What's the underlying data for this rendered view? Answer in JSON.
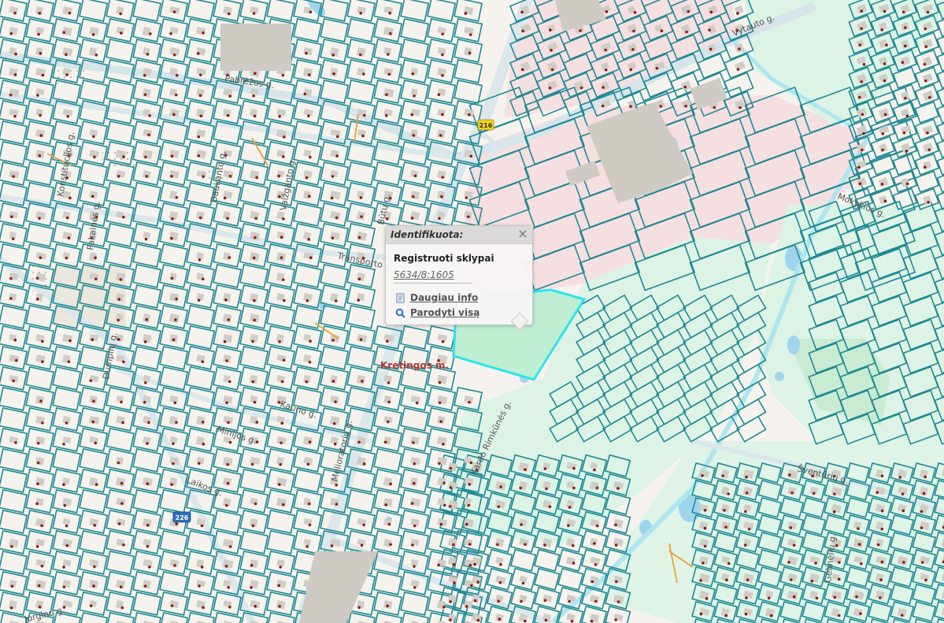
{
  "map": {
    "streets": [
      "Vytauto g.",
      "Pabrėžos g.",
      "Konstitucijos g.",
      "Daukanto g.",
      "Vaižganto g.",
      "Pakalnės g.",
      "Būtų g.",
      "Transporto g.",
      "Kauno g.",
      "Melioratorių g.",
      "Minijos g.",
      "Mokyklos g.",
      "Kardo Rimkūnės g.",
      "Šventūrių g.",
      "Gėlinėlių g.",
      "Jurginų g.",
      "Laikos g.",
      "Dumplių g."
    ],
    "road_numbers": [
      "216",
      "226"
    ],
    "place_label": "Kretingos m."
  },
  "popup": {
    "title": "Identifikuota:",
    "close_symbol": "×",
    "layer_name": "Registruoti sklypai",
    "parcel_id": "5634/8:1605",
    "more_info_label": "Daugiau info",
    "show_all_label": "Parodyti visą"
  },
  "colors": {
    "parcel_line": "#1e8a94",
    "selected_parcel": "#2de3ee",
    "industrial": "#f6dfe1",
    "green": "#ddf3e6",
    "building": "#d0ccc6",
    "point": "#8b1d13"
  }
}
